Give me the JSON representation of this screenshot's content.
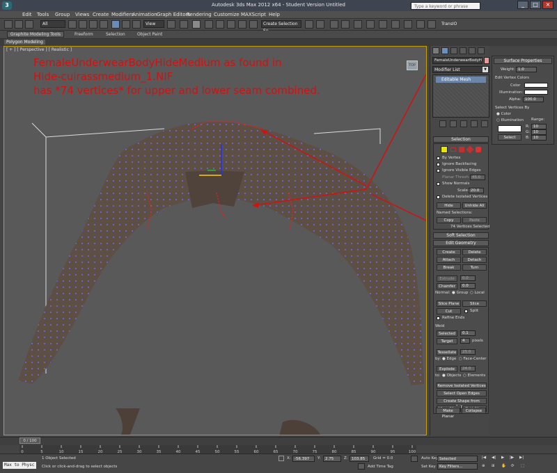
{
  "window": {
    "title": "Autodesk 3ds Max  2012 x64  -  Student Version    Untitled",
    "search_placeholder": "Type a keyword or phrase"
  },
  "menu": [
    "Edit",
    "Tools",
    "Group",
    "Views",
    "Create",
    "Modifiers",
    "Animation",
    "Graph Editors",
    "Rendering",
    "Customize",
    "MAXScript",
    "Help"
  ],
  "toolbar": {
    "selection_filter": "All",
    "ref_coord": "View",
    "named_selection": "Create Selection Se",
    "transio": "TransIO"
  },
  "ribbon": {
    "tabs": [
      "Graphite Modeling Tools",
      "Freeform",
      "Selection",
      "Object Paint"
    ],
    "active": "Graphite Modeling Tools",
    "sub": "Polygon Modeling"
  },
  "viewport": {
    "label": "[ + ] [ Perspective ] [ Realistic ]",
    "annotation": [
      "FemaleUnderwearBodyHideMedium as found in",
      "Hide-cuirassmedium_1.NIF",
      "has *74 vertices* for upper and lower seam combined."
    ],
    "annotation_color": "#d41010"
  },
  "command_panel": {
    "object_name": "FemaleUnderwearBodyHideM",
    "modifier_list": "Modifier List",
    "stack_item": "Editable Mesh",
    "selection": {
      "title": "Selection",
      "by_vertex": "By Vertex",
      "ignore_backfacing": "Ignore Backfacing",
      "ignore_visible_edges": "Ignore Visible Edges",
      "planar_thresh": "Planar Thresh:",
      "planar_val": "45.0",
      "show_normals": "Show Normals",
      "scale_label": "Scale:",
      "scale_val": "20.0",
      "delete_isolated": "Delete Isolated Vertices",
      "hide": "Hide",
      "unhide_all": "Unhide All",
      "named_selections": "Named Selections:",
      "copy": "Copy",
      "paste": "Paste",
      "status": "74 Vertices Selected"
    },
    "soft_selection": "Soft Selection",
    "edit_geometry": {
      "title": "Edit Geometry",
      "buttons": [
        [
          "Create",
          "Delete"
        ],
        [
          "Attach",
          "Detach"
        ],
        [
          "Break",
          "Turn"
        ]
      ],
      "extrude": "Extrude",
      "extrude_val": "0.0",
      "chamfer": "Chamfer",
      "chamfer_val": "0.0",
      "normal_label": "Normal:",
      "group": "Group",
      "local": "Local",
      "slice_plane": "Slice Plane",
      "slice": "Slice",
      "cut": "Cut",
      "split": "Split",
      "refine_ends": "Refine Ends",
      "weld": "Weld",
      "selected": "Selected",
      "selected_val": "0.1",
      "target": "Target",
      "target_val": "4",
      "pixels": "pixels",
      "tessellate": "Tessellate",
      "tess_val": "25.0",
      "by_label": "by:",
      "edge": "Edge",
      "face_center": "Face-Center",
      "explode": "Explode",
      "explode_val": "24.0",
      "to_label": "to:",
      "objects": "Objects",
      "elements": "Elements",
      "remove_isolated": "Remove Isolated Vertices",
      "select_open_edges": "Select Open Edges",
      "create_shape": "Create Shape from Edges",
      "view_align": "View Align",
      "grid_align": "Grid Align",
      "make_planar": "Make Planar",
      "collapse": "Collapse"
    }
  },
  "surface_properties": {
    "title": "Surface Properties",
    "weight_label": "Weight:",
    "weight_val": "1.0",
    "edit_vertex_colors": "Edit Vertex Colors",
    "color": "Color",
    "illumination": "Illumination:",
    "alpha": "Alpha:",
    "alpha_val": "100.0",
    "select_vertices_by": "Select Vertices By",
    "color_radio": "Color",
    "illum_radio": "Illumination",
    "range": "Range:",
    "r": "R:",
    "r_val": "10",
    "g": "G:",
    "g_val": "10",
    "b": "B:",
    "b_val": "10",
    "select": "Select"
  },
  "timeline": {
    "frame": "0 / 100",
    "ticks": [
      "0",
      "5",
      "10",
      "15",
      "20",
      "25",
      "30",
      "35",
      "40",
      "45",
      "50",
      "55",
      "60",
      "65",
      "70",
      "75",
      "80",
      "85",
      "90",
      "95",
      "100"
    ]
  },
  "status": {
    "maxscript": "Max to Physc",
    "selected": "1 Object Selected",
    "prompt": "Click or click-and-drag to select objects",
    "x_label": "X:",
    "x_val": "-56.397",
    "y_label": "Y:",
    "y_val": "2.75",
    "z_label": "Z:",
    "z_val": "103.85",
    "grid": "Grid = 0.0",
    "auto_key": "Auto Key",
    "set_key": "Set Key",
    "selected_dd": "Selected",
    "key_filters": "Key Filters...",
    "add_time_tag": "Add Time Tag"
  }
}
